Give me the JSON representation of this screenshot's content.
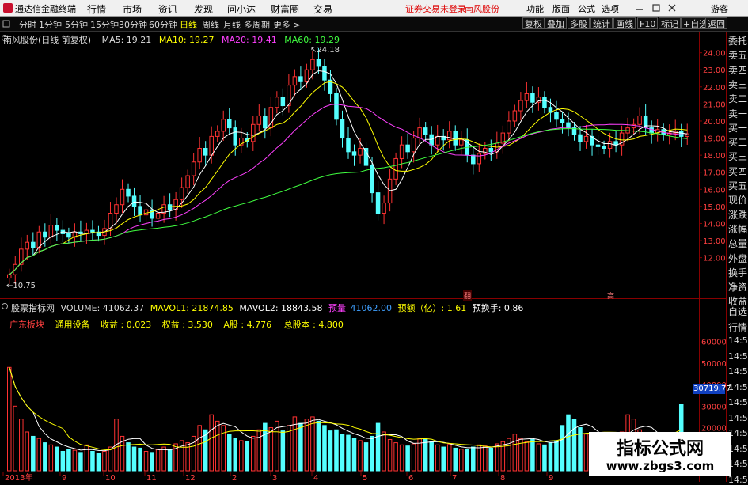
{
  "menubar": {
    "app_title": "通达信金融终端",
    "items": [
      "行情",
      "市场",
      "资讯",
      "发现",
      "问小达",
      "财富圈",
      "交易"
    ],
    "warning": "证券交易未登录",
    "stock": "南风股份",
    "right_items": [
      "功能",
      "版面",
      "公式",
      "选项"
    ],
    "user": "游客"
  },
  "toolbar": {
    "periods": [
      "分时",
      "1分钟",
      "5分钟",
      "15分钟",
      "30分钟",
      "60分钟",
      "日线",
      "周线",
      "月线",
      "多周期",
      "更多 >"
    ],
    "active_period": "日线",
    "right_buttons": [
      "复权",
      "叠加",
      "多股",
      "统计",
      "画线",
      "F10",
      "标记",
      "+自选",
      "返回"
    ]
  },
  "main_legend": {
    "title": "南风股份(日线 前复权)",
    "ma": [
      {
        "label": "MA5: 19.21",
        "color": "#ffffff"
      },
      {
        "label": "MA10: 19.27",
        "color": "#ffff00"
      },
      {
        "label": "MA20: 19.41",
        "color": "#ff40ff"
      },
      {
        "label": "MA60: 19.29",
        "color": "#40ff40"
      }
    ],
    "high_label": "24.18",
    "low_label": "10.75"
  },
  "sub_legend": {
    "title": "股票指标网",
    "items": [
      {
        "label": "VOLUME: 41062.37",
        "color": "#dddddd"
      },
      {
        "label": "MAVOL1: 21874.85",
        "color": "#ffff00"
      },
      {
        "label": "MAVOL2: 18843.58",
        "color": "#ffffff"
      },
      {
        "label": "预量",
        "color": "#ff40ff"
      },
      {
        "label": "41062.00",
        "color": "#40a0ff"
      },
      {
        "label": "预额（亿）: 1.61",
        "color": "#ffff00"
      },
      {
        "label": "预换手: 0.86",
        "color": "#ffffff"
      }
    ],
    "info": [
      {
        "label": "广东板块",
        "color": "#ff4040"
      },
      {
        "label": "通用设备",
        "color": "#ffff00"
      },
      {
        "label": "收益 : 0.023",
        "color": "#ffff00"
      },
      {
        "label": "权益 : 3.530",
        "color": "#ffff00"
      },
      {
        "label": "A股 : 4.776",
        "color": "#ffff00"
      },
      {
        "label": "总股本 : 4.800",
        "color": "#ffff00"
      }
    ]
  },
  "price_ticks": [
    "24.00",
    "23.00",
    "22.00",
    "21.00",
    "20.00",
    "19.00",
    "18.00",
    "17.00",
    "16.00",
    "15.00",
    "14.00",
    "13.00",
    "12.00"
  ],
  "volume_ticks": [
    "60000",
    "50000",
    "40000",
    "30000",
    "20000"
  ],
  "volume_current": "30719.77",
  "x_ticks": [
    "2013年",
    "9",
    "10",
    "11",
    "12",
    "2",
    "3",
    "4",
    "5",
    "6",
    "7",
    "8",
    "9"
  ],
  "right_panel": [
    "委托",
    "卖五",
    "卖四",
    "卖三",
    "卖二",
    "卖一",
    "买一",
    "买二",
    "买三",
    "买四",
    "买五",
    "现价",
    "涨跌",
    "涨幅",
    "总量",
    "外盘",
    "换手",
    "净资",
    "收益"
  ],
  "right_panel_lower": [
    "自选",
    "行情",
    "14:5",
    "14:5",
    "14:5",
    "14:5",
    "14:5",
    "14:5",
    "14:5",
    "14:5",
    "14:5",
    "14:5"
  ],
  "event_marks": [
    "翻",
    "高"
  ],
  "watermark": {
    "line1": "指标公式网",
    "line2": "www.zbgs3.com"
  },
  "chart_data": [
    {
      "type": "candlestick",
      "title": "南风股份(日线 前复权)",
      "ylim": [
        10.5,
        24.4
      ],
      "grid": false,
      "series": [
        {
          "name": "MA5",
          "value": 19.21
        },
        {
          "name": "MA10",
          "value": 19.27
        },
        {
          "name": "MA20",
          "value": 19.41
        },
        {
          "name": "MA60",
          "value": 19.29
        }
      ],
      "annotations": [
        {
          "label": "24.18",
          "value": 24.18
        },
        {
          "label": "10.75",
          "value": 10.75
        }
      ],
      "closes": [
        11.0,
        11.6,
        12.5,
        12.9,
        12.6,
        13.5,
        13.2,
        13.9,
        13.6,
        13.4,
        13.2,
        13.5,
        13.4,
        13.6,
        13.5,
        13.3,
        13.7,
        14.6,
        15.1,
        16.0,
        15.6,
        15.0,
        14.5,
        14.8,
        14.3,
        14.6,
        15.1,
        14.8,
        15.4,
        16.1,
        16.8,
        17.6,
        18.4,
        18.0,
        19.1,
        19.4,
        20.1,
        19.6,
        18.6,
        19.0,
        18.8,
        19.8,
        20.3,
        19.6,
        20.8,
        21.4,
        20.9,
        22.1,
        22.6,
        22.3,
        23.0,
        23.6,
        23.2,
        22.4,
        21.6,
        20.1,
        19.0,
        18.2,
        18.0,
        18.4,
        17.4,
        15.8,
        14.6,
        15.2,
        16.6,
        17.8,
        18.6,
        18.2,
        19.0,
        19.6,
        19.2,
        18.6,
        19.1,
        18.9,
        19.4,
        18.6,
        18.9,
        18.0,
        17.5,
        18.1,
        18.4,
        18.2,
        18.7,
        19.3,
        20.0,
        20.6,
        21.2,
        21.6,
        21.1,
        21.4,
        20.8,
        20.5,
        20.1,
        19.9,
        19.6,
        19.2,
        18.8,
        19.1,
        18.6,
        18.5,
        18.4,
        18.8,
        18.6,
        19.3,
        19.6,
        19.8,
        20.3,
        19.6,
        19.3,
        19.5,
        19.2,
        19.3,
        19.4,
        19.1,
        19.25
      ]
    },
    {
      "type": "bar",
      "title": "VOLUME",
      "ylim": [
        0,
        65000
      ],
      "series": [
        {
          "name": "VOLUME",
          "value": 41062.37
        },
        {
          "name": "MAVOL1",
          "value": 21874.85
        },
        {
          "name": "MAVOL2",
          "value": 18843.58
        }
      ],
      "values": [
        48000,
        30000,
        24000,
        18000,
        16000,
        15000,
        13000,
        12000,
        11000,
        9000,
        10000,
        9500,
        8500,
        12000,
        9000,
        8000,
        9000,
        11000,
        24000,
        16000,
        13000,
        11000,
        10500,
        9000,
        8500,
        9800,
        11000,
        10000,
        12500,
        14000,
        13000,
        16000,
        21000,
        19000,
        26000,
        23000,
        21000,
        17000,
        15000,
        14000,
        13500,
        16000,
        19000,
        22000,
        20000,
        23000,
        18500,
        21000,
        25000,
        22000,
        24000,
        25000,
        23000,
        21000,
        18500,
        19000,
        17000,
        16500,
        15000,
        14000,
        13000,
        16000,
        22000,
        18000,
        14500,
        13000,
        12000,
        11500,
        12500,
        15000,
        14500,
        13500,
        12000,
        11000,
        12200,
        10500,
        10000,
        9800,
        11000,
        12000,
        11500,
        10500,
        12500,
        13500,
        15000,
        17000,
        15000,
        13500,
        14500,
        12500,
        12000,
        13000,
        14000,
        21000,
        26000,
        24000,
        20000,
        17000,
        15500,
        14500,
        14000,
        13000,
        13500,
        18000,
        26000,
        24000,
        19000,
        16500,
        15000,
        14000,
        13000,
        15000,
        17000,
        30719.77
      ]
    }
  ]
}
